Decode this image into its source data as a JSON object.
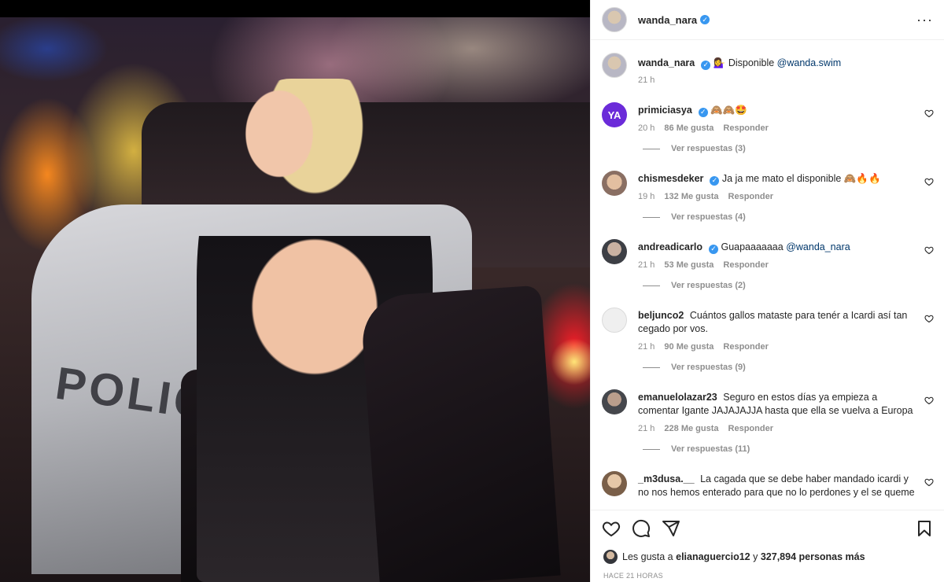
{
  "post": {
    "author": "wanda_nara",
    "caption_emoji": "💁‍♀️",
    "caption_text": "Disponible",
    "caption_mention": "@wanda.swim",
    "caption_time": "21 h",
    "photo_sign": "POLICE"
  },
  "header": {
    "username": "wanda_nara",
    "more_label": "···"
  },
  "comments": [
    {
      "username": "primiciasya",
      "verified": true,
      "text": "🙈🙈🤩",
      "mention": "",
      "time": "20 h",
      "likes": "86 Me gusta",
      "reply": "Responder",
      "replies": "Ver respuestas (3)",
      "avatar_text": "YA"
    },
    {
      "username": "chismesdeker",
      "verified": true,
      "text": "Ja ja me mato el disponible 🙈🔥🔥",
      "mention": "",
      "time": "19 h",
      "likes": "132 Me gusta",
      "reply": "Responder",
      "replies": "Ver respuestas (4)"
    },
    {
      "username": "andreadicarlo",
      "verified": true,
      "text": "Guapaaaaaaa",
      "mention": "@wanda_nara",
      "time": "21 h",
      "likes": "53 Me gusta",
      "reply": "Responder",
      "replies": "Ver respuestas (2)"
    },
    {
      "username": "beljunco2",
      "verified": false,
      "text": "Cuántos gallos mataste para tenér a Icardi así tan cegado por vos.",
      "mention": "",
      "time": "21 h",
      "likes": "90 Me gusta",
      "reply": "Responder",
      "replies": "Ver respuestas (9)"
    },
    {
      "username": "emanuelolazar23",
      "verified": false,
      "text": "Seguro en estos días ya empieza a comentar Igante JAJAJAJJA hasta que ella se vuelva a Europa",
      "mention": "",
      "time": "21 h",
      "likes": "228 Me gusta",
      "reply": "Responder",
      "replies": "Ver respuestas (11)"
    },
    {
      "username": "_m3dusa.__",
      "verified": false,
      "text": "La cagada que se debe haber mandado icardi y no nos hemos enterado para que no lo perdones y el se queme",
      "mention": "",
      "time": "",
      "likes": "",
      "reply": "",
      "replies": ""
    }
  ],
  "likes_line": {
    "prefix": "Les gusta a",
    "user": "elianaguercio12",
    "middle": "y",
    "count": "327,894 personas más"
  },
  "timestamp": "Hace 21 horas",
  "icons": {
    "like": "heart-icon",
    "comment": "comment-icon",
    "share": "share-icon",
    "save": "bookmark-icon",
    "more": "more-icon",
    "verified": "verified-badge-icon"
  },
  "colors": {
    "verified": "#3897f0",
    "mention": "#00376b",
    "muted": "#8e8e8e",
    "text": "#262626",
    "divider": "#efefef"
  }
}
